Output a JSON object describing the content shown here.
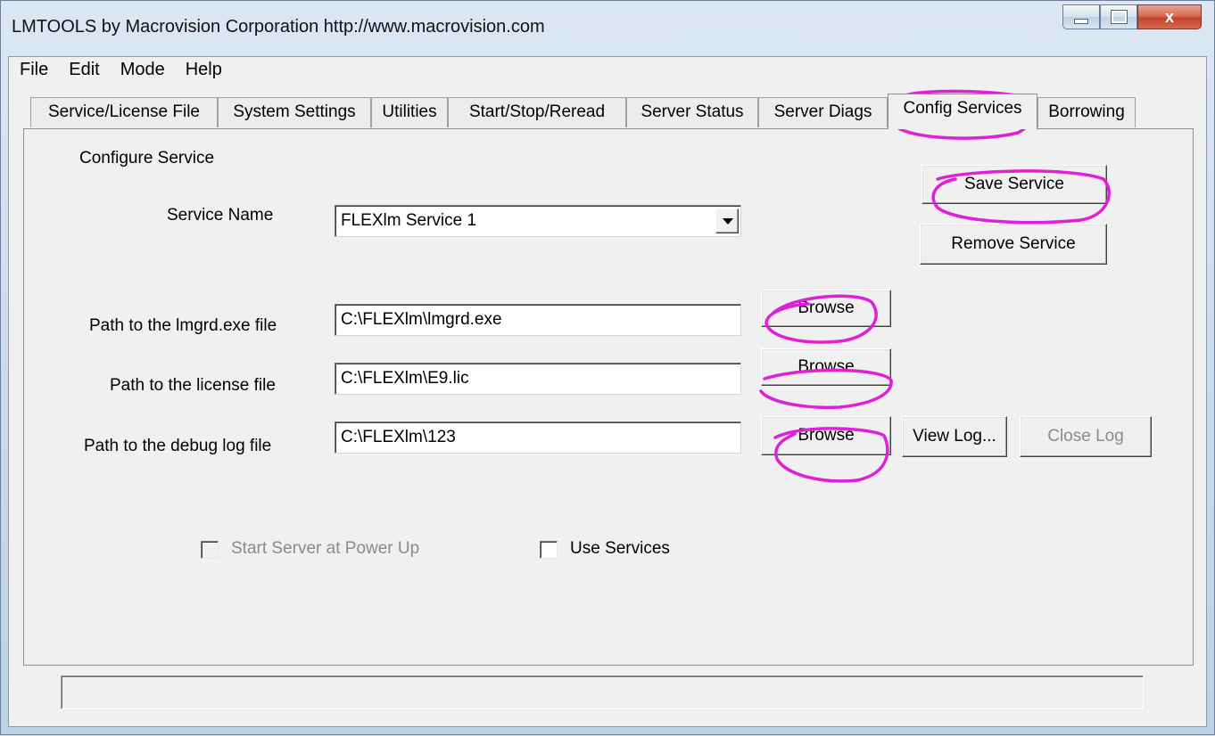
{
  "window": {
    "title": "LMTOOLS by Macrovision Corporation http://www.macrovision.com",
    "controls": {
      "minimize": "minimize",
      "maximize": "maximize",
      "close": "x"
    }
  },
  "menu": {
    "items": [
      "File",
      "Edit",
      "Mode",
      "Help"
    ]
  },
  "tabs": [
    {
      "label": "Service/License File"
    },
    {
      "label": "System Settings"
    },
    {
      "label": "Utilities"
    },
    {
      "label": "Start/Stop/Reread"
    },
    {
      "label": "Server Status"
    },
    {
      "label": "Server Diags"
    },
    {
      "label": "Config Services",
      "active": true
    },
    {
      "label": "Borrowing"
    }
  ],
  "config": {
    "section_label": "Configure Service",
    "service_name_label": "Service Name",
    "service_name_value": "FLEXlm Service 1",
    "lmgrd_label": "Path to the lmgrd.exe file",
    "lmgrd_value": "C:\\FLEXlm\\lmgrd.exe",
    "license_label": "Path to the license file",
    "license_value": "C:\\FLEXlm\\E9.lic",
    "debug_label": "Path to the debug log file",
    "debug_value": "C:\\FLEXlm\\123",
    "save_service": "Save Service",
    "remove_service": "Remove Service",
    "browse": "Browse",
    "view_log": "View Log...",
    "close_log": "Close Log",
    "start_server_label": "Start Server at Power Up",
    "use_services_label": "Use Services"
  },
  "status": {
    "text": ""
  },
  "annotation_color": "#e020d8"
}
